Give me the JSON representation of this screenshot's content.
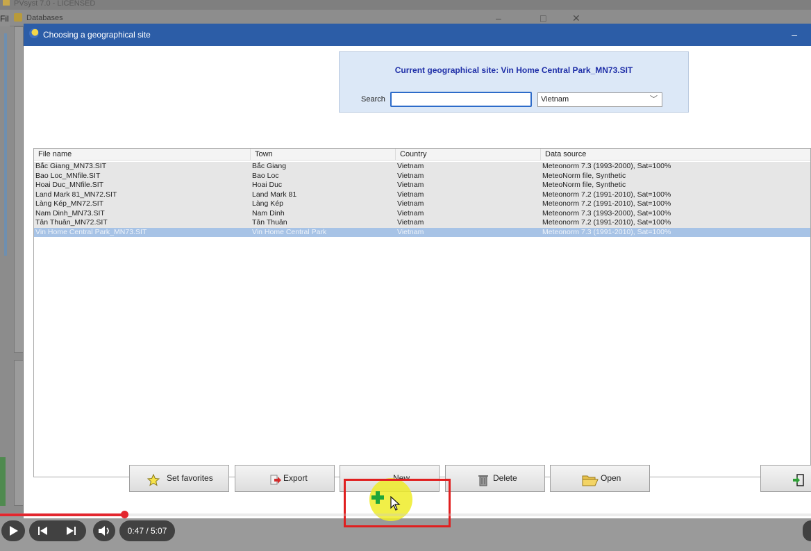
{
  "background_app": {
    "title": "PVsyst 7.0 - LICENSED",
    "menu_label": "Fil",
    "databases_label": "Databases",
    "window_controls": [
      "–",
      "□",
      "✕"
    ]
  },
  "dialog": {
    "title": "Choosing a geographical site",
    "minimize": "–",
    "current_site": "Current geographical site: Vin Home Central Park_MN73.SIT",
    "search_label": "Search",
    "search_value": "",
    "country_selected": "Vietnam",
    "columns": [
      "File name",
      "Town",
      "Country",
      "Data source"
    ],
    "rows": [
      {
        "file": "Bắc Giang_MN73.SIT",
        "town": "Bắc Giang",
        "country": "Vietnam",
        "source": "Meteonorm 7.3 (1993-2000), Sat=100%"
      },
      {
        "file": "Bao Loc_MNfile.SIT",
        "town": "Bao Loc",
        "country": "Vietnam",
        "source": "MeteoNorm file, Synthetic"
      },
      {
        "file": "Hoai Duc_MNfile.SIT",
        "town": "Hoai Duc",
        "country": "Vietnam",
        "source": "MeteoNorm file, Synthetic"
      },
      {
        "file": "Land Mark 81_MN72.SIT",
        "town": "Land Mark 81",
        "country": "Vietnam",
        "source": "Meteonorm 7.2 (1991-2010), Sat=100%"
      },
      {
        "file": "Làng Kép_MN72.SIT",
        "town": "Làng Kép",
        "country": "Vietnam",
        "source": "Meteonorm 7.2 (1991-2010), Sat=100%"
      },
      {
        "file": "Nam Dinh_MN73.SIT",
        "town": "Nam Dinh",
        "country": "Vietnam",
        "source": "Meteonorm 7.3 (1993-2000), Sat=100%"
      },
      {
        "file": "Tân Thuân_MN72.SIT",
        "town": "Tân Thuân",
        "country": "Vietnam",
        "source": "Meteonorm 7.2 (1991-2010), Sat=100%"
      },
      {
        "file": "Vin Home Central Park_MN73.SIT",
        "town": "Vin Home Central Park",
        "country": "Vietnam",
        "source": "Meteonorm 7.3 (1991-2010), Sat=100%"
      }
    ],
    "selected_row_index": 7,
    "buttons": {
      "favorites": "Set favorites",
      "export": "Export",
      "new": "New",
      "delete": "Delete",
      "open": "Open"
    }
  },
  "player": {
    "time": "0:47 / 5:07",
    "progress_fraction": 0.153
  },
  "colors": {
    "title_bar": "#2c5da7",
    "current_site_text": "#1f2fa8",
    "selected_row": "#a7c3e6",
    "highlight": "#e01f1f",
    "progress": "#e3262e"
  }
}
